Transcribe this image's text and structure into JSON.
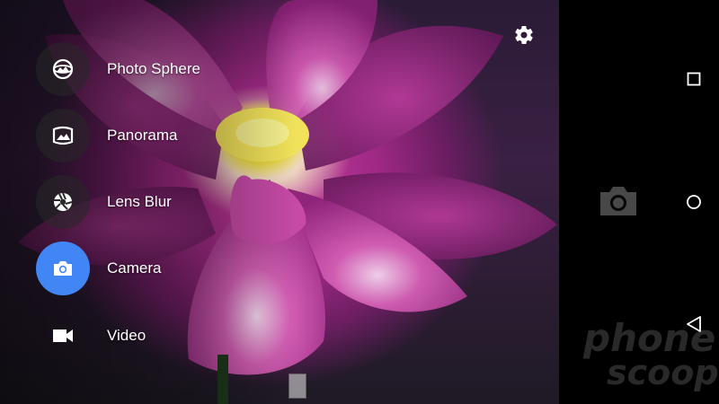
{
  "modes": [
    {
      "label": "Photo Sphere",
      "icon": "photo-sphere-icon",
      "state": "inactive"
    },
    {
      "label": "Panorama",
      "icon": "panorama-icon",
      "state": "inactive"
    },
    {
      "label": "Lens Blur",
      "icon": "lens-blur-icon",
      "state": "inactive"
    },
    {
      "label": "Camera",
      "icon": "camera-icon",
      "state": "selected"
    },
    {
      "label": "Video",
      "icon": "video-icon",
      "state": "inactive"
    }
  ],
  "settings": {
    "icon": "gear-icon"
  },
  "shutter": {
    "icon": "camera-icon"
  },
  "navigation": {
    "recents_icon": "square-icon",
    "home_icon": "circle-icon",
    "back_icon": "triangle-back-icon"
  },
  "watermark": {
    "line1": "phone",
    "line2": "scoop"
  },
  "colors": {
    "accent": "#4285f4",
    "label": "#ffffff",
    "background": "#000000"
  }
}
